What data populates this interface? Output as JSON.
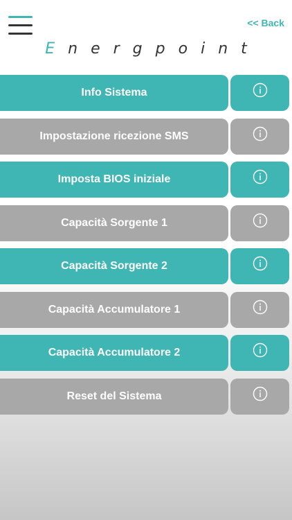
{
  "header": {
    "back_label": "<< Back",
    "logo_letters": [
      "E",
      "n",
      "e",
      "r",
      "g",
      "p",
      "o",
      "i",
      "n",
      "t"
    ]
  },
  "colors": {
    "accent": "#3fb6b4",
    "inactive": "#a8a8a8",
    "text": "#333333"
  },
  "menu": {
    "items": [
      {
        "label": "Info Sistema",
        "style": "teal"
      },
      {
        "label": "Impostazione ricezione SMS",
        "style": "grey"
      },
      {
        "label": "Imposta BIOS iniziale",
        "style": "teal"
      },
      {
        "label": "Capacità Sorgente 1",
        "style": "grey"
      },
      {
        "label": "Capacità Sorgente 2",
        "style": "teal"
      },
      {
        "label": "Capacità Accumulatore 1",
        "style": "grey"
      },
      {
        "label": "Capacità Accumulatore 2",
        "style": "teal"
      },
      {
        "label": "Reset del Sistema",
        "style": "grey"
      }
    ],
    "info_icon": "info-circle-icon"
  }
}
